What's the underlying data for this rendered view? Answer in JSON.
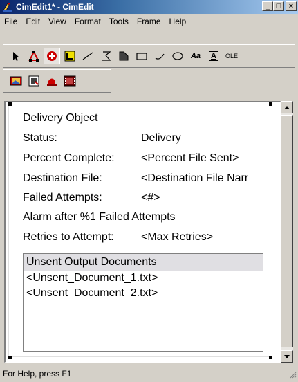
{
  "window": {
    "title": "CimEdit1* - CimEdit",
    "minimize": "_",
    "maximize": "□",
    "close": "×"
  },
  "menu": [
    "File",
    "Edit",
    "View",
    "Format",
    "Tools",
    "Frame",
    "Help"
  ],
  "toolbar": {
    "text_tool_label": "Aa",
    "text_box_label": "A",
    "ole_label": "OLE"
  },
  "canvas": {
    "rows": [
      {
        "label": "Delivery Object",
        "value": ""
      },
      {
        "label": "Status:",
        "value": "Delivery"
      },
      {
        "label": "Percent Complete:",
        "value": "<Percent File Sent>"
      },
      {
        "label": "Destination File:",
        "value": "<Destination File Narr"
      },
      {
        "label": "Failed Attempts:",
        "value": "<#>"
      },
      {
        "label": "Alarm after %1 Failed Attempts",
        "value": ""
      },
      {
        "label": "Retries to Attempt:",
        "value": "<Max Retries>"
      }
    ],
    "list": {
      "header": "Unsent Output Documents",
      "items": [
        "<Unsent_Document_1.txt>",
        "<Unsent_Document_2.txt>"
      ]
    }
  },
  "status": {
    "text": "For Help, press F1"
  },
  "colors": {
    "title_start": "#0a246a",
    "title_end": "#a6caf0",
    "face": "#d4d0c8"
  }
}
